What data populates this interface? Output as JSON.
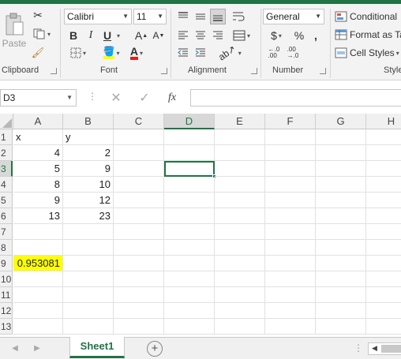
{
  "ribbon": {
    "paste_label": "Paste",
    "font_name": "Calibri",
    "font_size": "11",
    "number_format": "General",
    "conditional_label": "Conditional",
    "format_table_label": "Format as Ta",
    "cell_styles_label": "Cell Styles",
    "groups": {
      "clipboard": "Clipboard",
      "font": "Font",
      "alignment": "Alignment",
      "number": "Number",
      "styles": "Style"
    },
    "bold": "B",
    "italic": "I",
    "underline": "U",
    "currency": "$",
    "percent": "%",
    "comma": ","
  },
  "formula_bar": {
    "name_box": "D3",
    "fx": "fx",
    "formula": ""
  },
  "sheet": {
    "columns": [
      "A",
      "B",
      "C",
      "D",
      "E",
      "F",
      "G",
      "H"
    ],
    "active_column": "D",
    "rows": [
      "1",
      "2",
      "3",
      "4",
      "5",
      "6",
      "7",
      "8",
      "9",
      "10",
      "11",
      "12",
      "13"
    ],
    "active_row": "3",
    "cells": {
      "A1": "x",
      "B1": "y",
      "A2": "4",
      "B2": "2",
      "A3": "5",
      "B3": "9",
      "A4": "8",
      "B4": "10",
      "A5": "9",
      "B5": "12",
      "A6": "13",
      "B6": "23",
      "A9": "0.953081"
    },
    "highlight_color": "#ffff00",
    "accent_color": "#217346"
  },
  "tabs": {
    "sheet_name": "Sheet1"
  }
}
